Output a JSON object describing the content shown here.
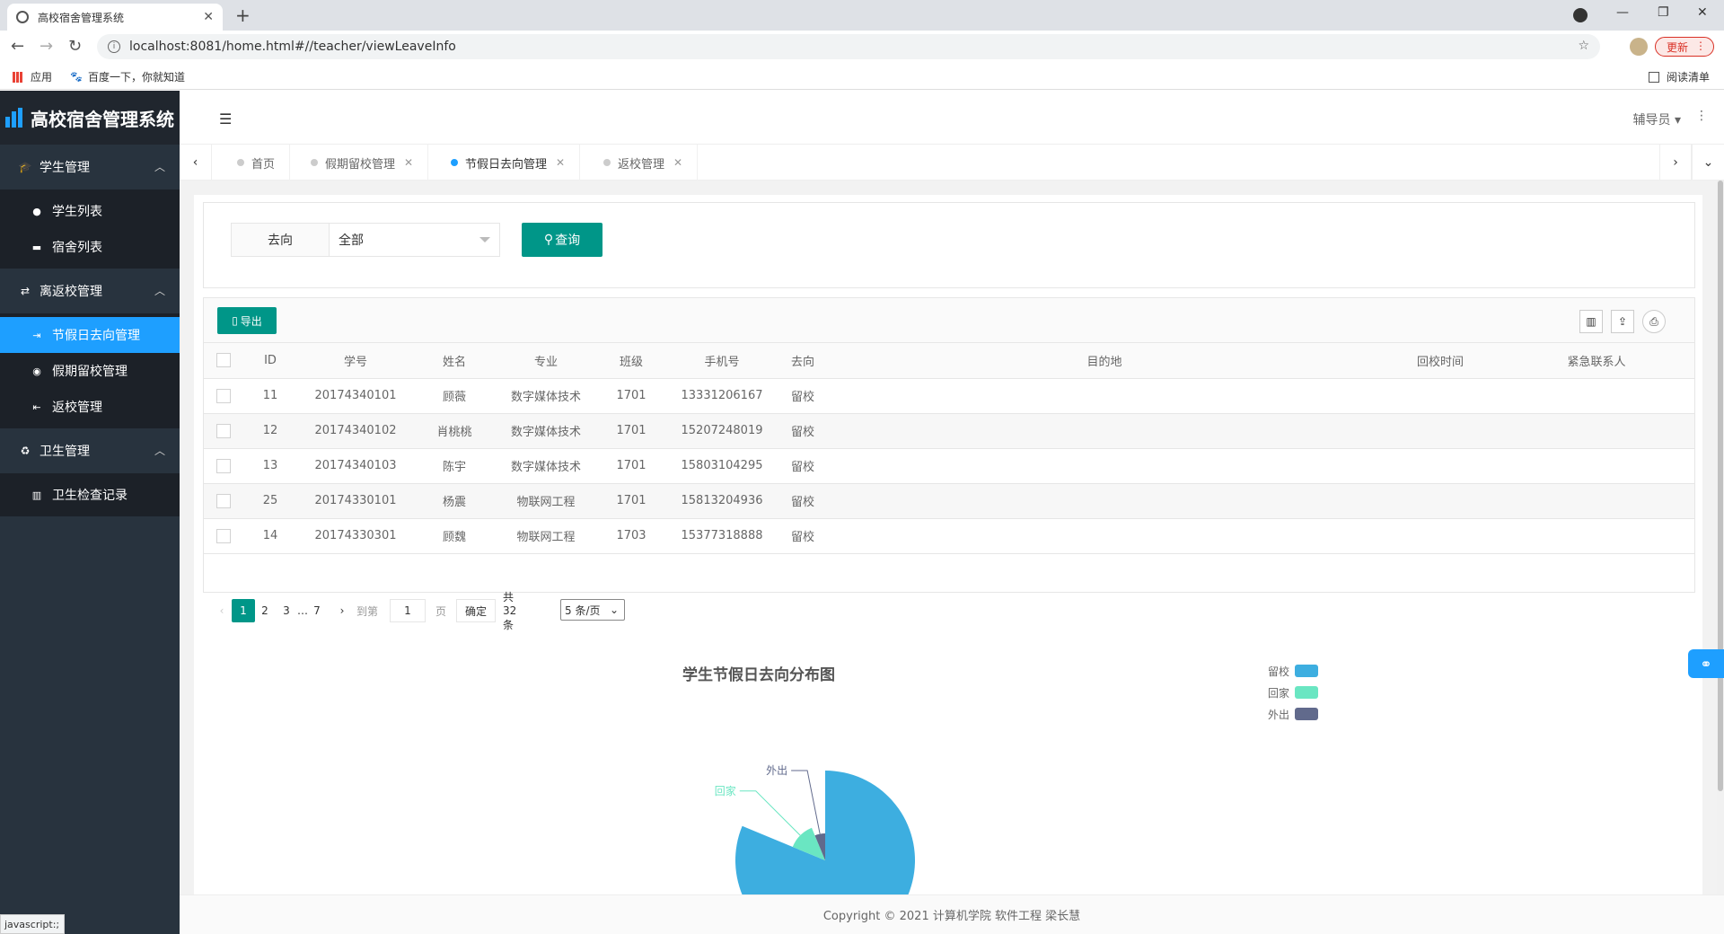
{
  "browser": {
    "tab_title": "高校宿舍管理系统",
    "url": "localhost:8081/home.html#//teacher/viewLeaveInfo",
    "update_label": "更新",
    "bookmarks": [
      "应用",
      "百度一下，你就知道"
    ],
    "reading_list": "阅读清单",
    "status_text": "javascript:;"
  },
  "app": {
    "brand": "高校宿舍管理系统",
    "user_label": "辅导员",
    "footer": "Copyright © 2021 计算机学院 软件工程 梁长慧"
  },
  "sidebar": {
    "groups": [
      {
        "label": "学生管理",
        "icon": "graduation-cap-icon",
        "items": [
          {
            "label": "学生列表",
            "icon": "user-icon"
          },
          {
            "label": "宿舍列表",
            "icon": "bed-icon"
          }
        ]
      },
      {
        "label": "离返校管理",
        "icon": "exchange-icon",
        "items": [
          {
            "label": "节假日去向管理",
            "icon": "sign-out-icon",
            "active": true
          },
          {
            "label": "假期留校管理",
            "icon": "globe-icon"
          },
          {
            "label": "返校管理",
            "icon": "sign-in-icon"
          }
        ]
      },
      {
        "label": "卫生管理",
        "icon": "recycle-icon",
        "items": [
          {
            "label": "卫生检查记录",
            "icon": "bar-chart-icon"
          }
        ]
      }
    ]
  },
  "page_tabs": [
    {
      "label": "首页"
    },
    {
      "label": "假期留校管理"
    },
    {
      "label": "节假日去向管理",
      "active": true
    },
    {
      "label": "返校管理"
    }
  ],
  "filter": {
    "label": "去向",
    "selected": "全部",
    "query_button": "查询"
  },
  "table": {
    "export_button": "导出",
    "columns": [
      "ID",
      "学号",
      "姓名",
      "专业",
      "班级",
      "手机号",
      "去向",
      "目的地",
      "回校时间",
      "紧急联系人"
    ],
    "rows": [
      [
        "11",
        "20174340101",
        "顾薇",
        "数字媒体技术",
        "1701",
        "13331206167",
        "留校",
        "",
        "",
        ""
      ],
      [
        "12",
        "20174340102",
        "肖桃桃",
        "数字媒体技术",
        "1701",
        "15207248019",
        "留校",
        "",
        "",
        ""
      ],
      [
        "13",
        "20174340103",
        "陈宇",
        "数字媒体技术",
        "1701",
        "15803104295",
        "留校",
        "",
        "",
        ""
      ],
      [
        "25",
        "20174330101",
        "杨震",
        "物联网工程",
        "1701",
        "15813204936",
        "留校",
        "",
        "",
        ""
      ],
      [
        "14",
        "20174330301",
        "顾魏",
        "物联网工程",
        "1703",
        "15377318888",
        "留校",
        "",
        "",
        ""
      ]
    ]
  },
  "pager": {
    "pages": [
      "1",
      "2",
      "3",
      "…",
      "7"
    ],
    "current": "1",
    "goto_label": "到第",
    "goto_value": "1",
    "page_unit": "页",
    "confirm": "确定",
    "total": "共 32 条",
    "page_size": "5 条/页"
  },
  "chart_data": {
    "type": "pie",
    "title": "学生节假日去向分布图",
    "categories": [
      "留校",
      "回家",
      "外出"
    ],
    "values": [
      26,
      4,
      2
    ],
    "colors": [
      "#3daee0",
      "#6ae6c2",
      "#616a8c"
    ],
    "rose": true,
    "legend_position": "top-right"
  }
}
